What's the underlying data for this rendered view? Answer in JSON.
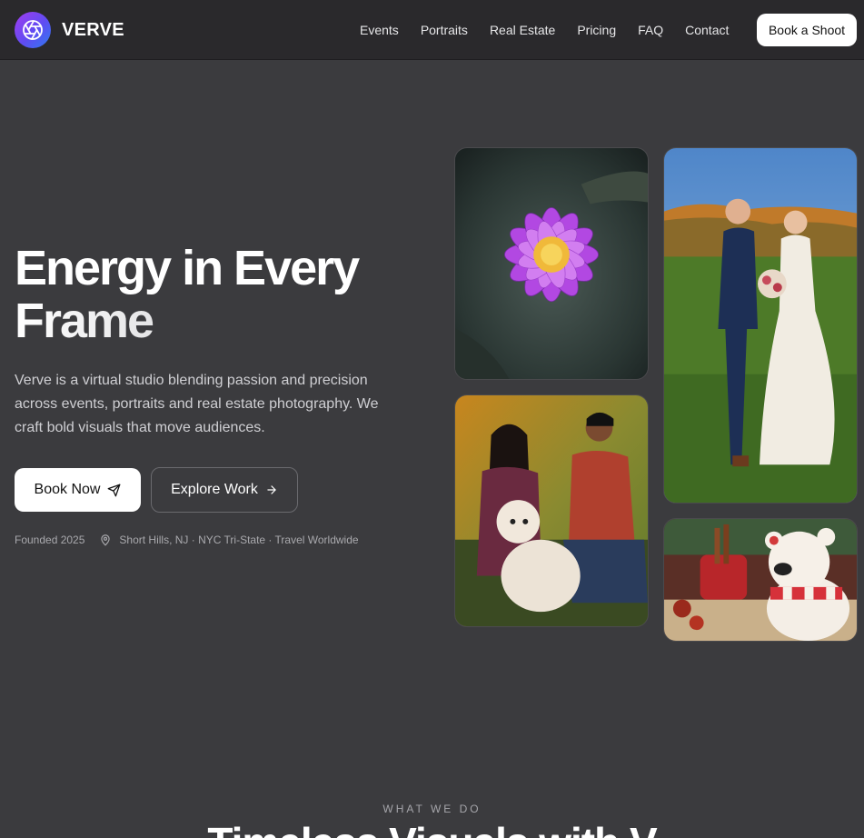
{
  "brand": {
    "name": "VERVE",
    "logo_icon": "aperture-icon",
    "logo_gradient": [
      "#a23cf0",
      "#2f7bf0"
    ]
  },
  "nav": {
    "links": [
      "Events",
      "Portraits",
      "Real Estate",
      "Pricing",
      "FAQ",
      "Contact"
    ],
    "cta": "Book a Shoot"
  },
  "hero": {
    "title_line1": "Energy in Every",
    "title_line2": "Frame",
    "description": "Verve is a virtual studio blending passion and precision across events, portraits and real estate photography. We craft bold visuals that move audiences.",
    "primary_button": {
      "label": "Book Now",
      "icon": "send-icon"
    },
    "secondary_button": {
      "label": "Explore Work",
      "icon": "arrow-right-icon"
    },
    "founded": "Founded 2025",
    "location_icon": "map-pin-icon",
    "location": "Short Hills, NJ · NYC Tri-State · Travel Worldwide"
  },
  "gallery": [
    {
      "name": "lotus-photo",
      "subject": "purple water lily"
    },
    {
      "name": "wedding-photo",
      "subject": "bride and groom"
    },
    {
      "name": "family-photo",
      "subject": "couple with dog"
    },
    {
      "name": "bear-photo",
      "subject": "ceramic polar bear"
    }
  ],
  "section": {
    "eyebrow": "WHAT WE DO",
    "title_partial": "Timeless Visuals with V"
  },
  "colors": {
    "background": "#3b3b3e",
    "nav": "#2a292c",
    "text_muted": "#cfcfd3"
  }
}
